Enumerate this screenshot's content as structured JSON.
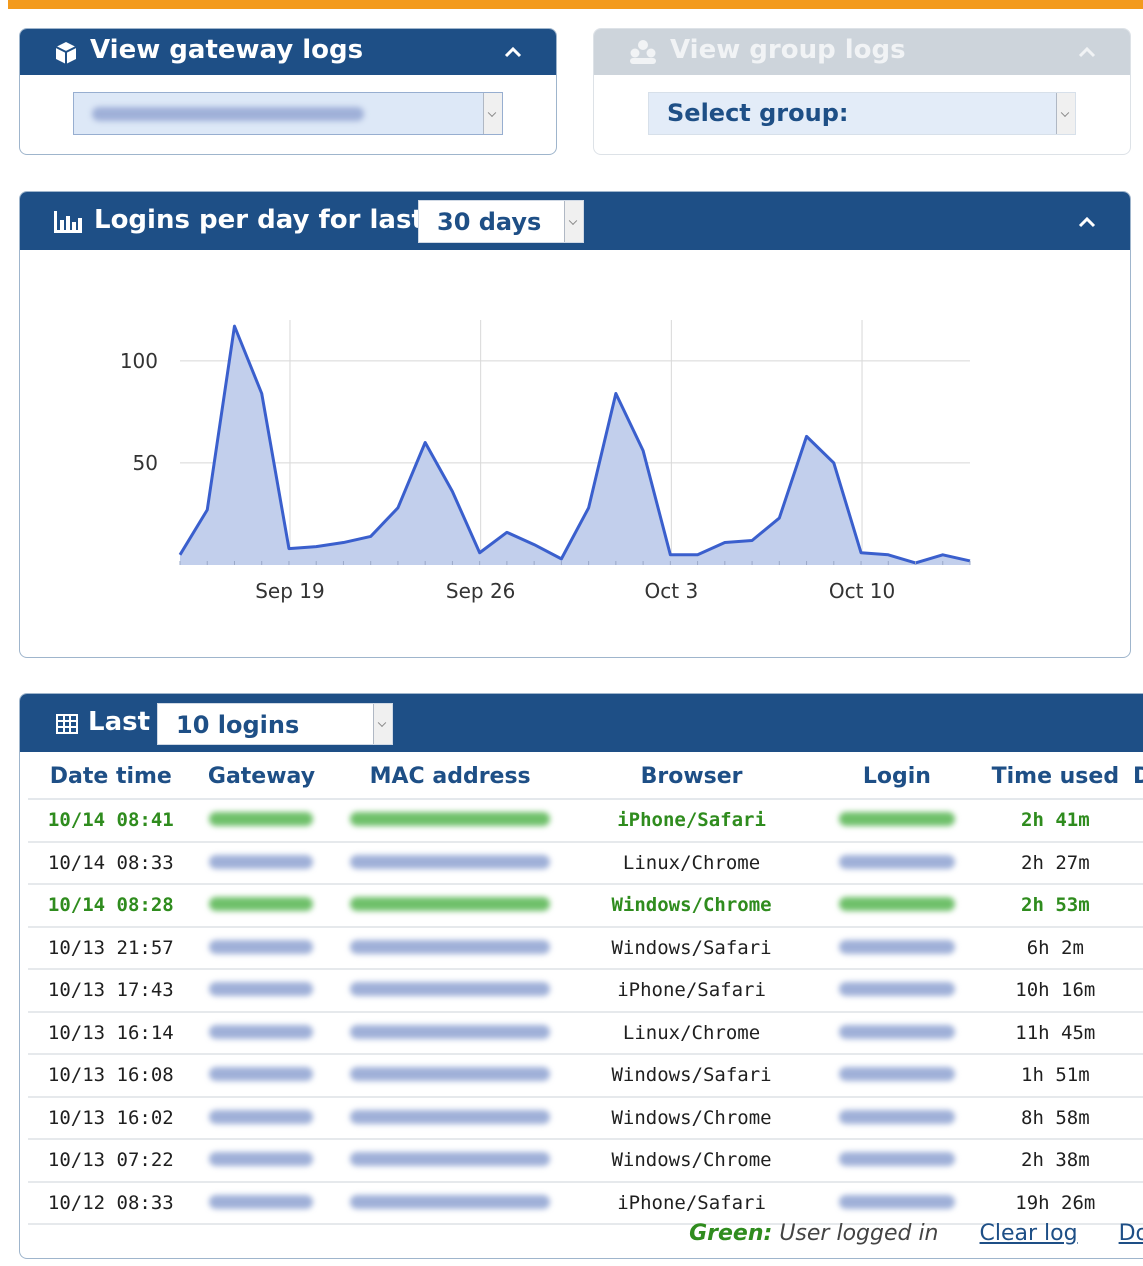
{
  "gateway_panel": {
    "title": "View gateway logs"
  },
  "group_panel": {
    "title": "View group logs",
    "select_placeholder": "Select group:"
  },
  "chart_panel": {
    "title": "Logins per day for last",
    "range_value": "30 days"
  },
  "chart_data": {
    "type": "area",
    "title": "",
    "xlabel": "",
    "ylabel": "",
    "x_tick_labels": [
      "Sep 19",
      "Sep 26",
      "Oct 3",
      "Oct 10"
    ],
    "y_tick_labels": [
      "50",
      "100"
    ],
    "ylim": [
      0,
      120
    ],
    "grid": true,
    "series": [
      {
        "values": [
          5,
          27,
          117,
          84,
          8,
          9,
          11,
          14,
          28,
          60,
          36,
          6,
          16,
          10,
          3,
          28,
          84,
          56,
          5,
          5,
          11,
          12,
          23,
          63,
          50,
          6,
          5,
          1,
          5,
          2
        ]
      }
    ],
    "colors": {
      "line": "#3a5fcd",
      "fill": "#c2cfec"
    }
  },
  "logins_panel": {
    "title": "Last",
    "count_value": "10 logins"
  },
  "table": {
    "columns": [
      "Date time",
      "Gateway",
      "MAC address",
      "Browser",
      "Login",
      "Time used",
      "D"
    ],
    "rows": [
      {
        "datetime": "10/14 08:41",
        "browser": "iPhone/Safari",
        "time_used": "2h 41m",
        "active": true
      },
      {
        "datetime": "10/14 08:33",
        "browser": "Linux/Chrome",
        "time_used": "2h 27m",
        "active": false
      },
      {
        "datetime": "10/14 08:28",
        "browser": "Windows/Chrome",
        "time_used": "2h 53m",
        "active": true
      },
      {
        "datetime": "10/13 21:57",
        "browser": "Windows/Safari",
        "time_used": "6h 2m",
        "active": false
      },
      {
        "datetime": "10/13 17:43",
        "browser": "iPhone/Safari",
        "time_used": "10h 16m",
        "active": false
      },
      {
        "datetime": "10/13 16:14",
        "browser": "Linux/Chrome",
        "time_used": "11h 45m",
        "active": false
      },
      {
        "datetime": "10/13 16:08",
        "browser": "Windows/Safari",
        "time_used": "1h 51m",
        "active": false
      },
      {
        "datetime": "10/13 16:02",
        "browser": "Windows/Chrome",
        "time_used": "8h 58m",
        "active": false
      },
      {
        "datetime": "10/13 07:22",
        "browser": "Windows/Chrome",
        "time_used": "2h 38m",
        "active": false
      },
      {
        "datetime": "10/12 08:33",
        "browser": "iPhone/Safari",
        "time_used": "19h 26m",
        "active": false
      }
    ]
  },
  "legend": {
    "green_label": "Green:",
    "green_text": "User logged in",
    "clear_log": "Clear log",
    "download": "Dow"
  },
  "icons": {
    "gateway": "cube-icon",
    "group": "users-icon",
    "chart": "bar-chart-icon",
    "table": "table-icon",
    "collapse": "chevron-up-icon"
  },
  "colors": {
    "accent_orange": "#f39a1c",
    "header_blue": "#1e4f86",
    "active_green": "#2f8c1e"
  }
}
